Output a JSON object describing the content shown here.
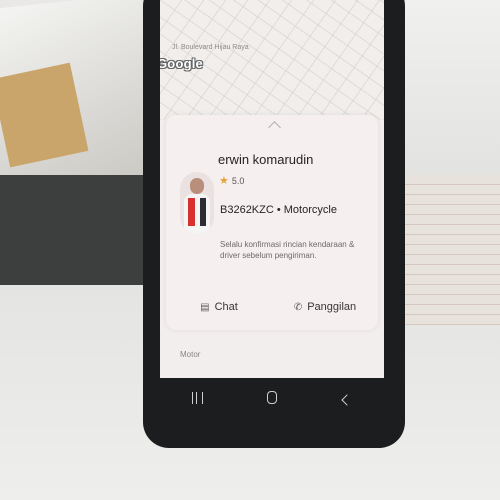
{
  "map": {
    "street_label": "Jl. Boulevard Hijau Raya",
    "logo_text": "Google"
  },
  "driver": {
    "name": "erwin komarudin",
    "rating": "5.0",
    "vehicle": "B3262KZC • Motorcycle",
    "note": "Selalu konfirmasi rincian kendaraan & driver sebelum pengiriman."
  },
  "actions": {
    "chat_label": "Chat",
    "call_label": "Panggilan"
  },
  "section": {
    "label": "Motor"
  },
  "icons": {
    "chat": "chat-bubble-icon",
    "call": "phone-icon",
    "star": "star-icon",
    "nav_recent": "recent-apps-icon",
    "nav_home": "home-icon",
    "nav_back": "back-icon"
  },
  "colors": {
    "star": "#e8a33a",
    "sheet_bg": "#f5efef"
  }
}
